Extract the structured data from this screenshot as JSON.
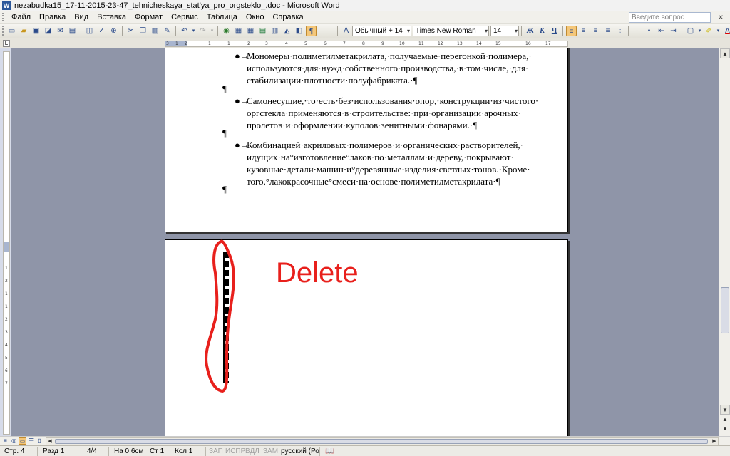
{
  "window": {
    "title": "nezabudka15_17-11-2015-23-47_tehnicheskaya_stat'ya_pro_orgsteklo_.doc - Microsoft Word",
    "app_icon": "W"
  },
  "menu": {
    "items": [
      "Файл",
      "Правка",
      "Вид",
      "Вставка",
      "Формат",
      "Сервис",
      "Таблица",
      "Окно",
      "Справка"
    ],
    "help_placeholder": "Введите вопрос",
    "close_glyph": "×"
  },
  "toolbar": {
    "style": "Обычный + 14 пт",
    "font": "Times New Roman",
    "size": "14",
    "bold": "Ж",
    "italic": "К",
    "underline": "Ч",
    "pilcrow": "¶"
  },
  "ruler": {
    "ticks": [
      "3",
      "1",
      "2",
      "1",
      "1",
      "2",
      "3",
      "4",
      "5",
      "6",
      "7",
      "8",
      "9",
      "10",
      "11",
      "12",
      "13",
      "14",
      "15",
      "16",
      "17"
    ]
  },
  "vruler": {
    "ticks": [
      "1",
      "2",
      "1",
      "1",
      "2",
      "3",
      "4",
      "5",
      "6",
      "7"
    ]
  },
  "document": {
    "page1": {
      "bullet_glyph": "●→",
      "pilcrow": "¶",
      "items": [
        {
          "lines": [
            "Мономеры·полиметилметакрилата,·получаемые·перегонкой·полимера,·",
            "используются·для·нужд·собственного·производства,·в·том·числе,·для·",
            "стабилизации·плотности·полуфабриката.·¶"
          ]
        },
        {
          "lines": [
            "Самонесущие,·то·есть·без·использования·опор,·конструкции·из·чистого·",
            "оргстекла·применяются·в·строительстве:·при·организации·арочных·",
            "пролетов·и·оформлении·куполов·зенитными·фонарями.·¶"
          ]
        },
        {
          "lines": [
            "Комбинацией·акриловых·полимеров·и·органических·растворителей,·",
            "идущих·на°изготовление°лаков·по·металлам·и·дереву,·покрывают·",
            "кузовные·детали·машин·и°деревянные·изделия·светлых·тонов.·Кроме·",
            "того,°лакокрасочные°смеси·на·основе·полиметилметакрилата·¶"
          ]
        }
      ]
    },
    "page2": {
      "annotation": "Delete"
    }
  },
  "statusbar": {
    "page": "Стр. 4",
    "section": "Разд 1",
    "pages": "4/4",
    "at": "На 0,6см",
    "line": "Ст 1",
    "col": "Кол 1",
    "rec": "ЗАП",
    "trk": "ИСПР",
    "ext": "ВДЛ",
    "ovr": "ЗАМ",
    "language": "русский (Ро"
  },
  "colors": {
    "annotation_red": "#e8201c",
    "workspace": "#8f95a8",
    "active_button": "#f4c77a"
  }
}
